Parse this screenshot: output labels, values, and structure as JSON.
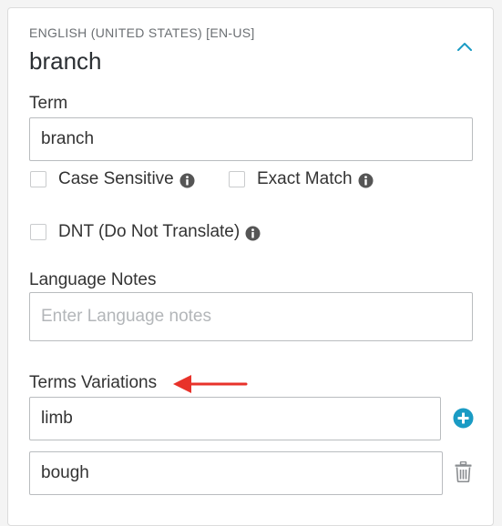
{
  "header": {
    "locale_label": "ENGLISH (UNITED STATES) [EN-US]",
    "term_title": "branch",
    "collapse_icon": "chevron-up-icon"
  },
  "term_field": {
    "label": "Term",
    "value": "branch"
  },
  "options": {
    "case_sensitive": {
      "label": "Case Sensitive",
      "checked": false
    },
    "exact_match": {
      "label": "Exact Match",
      "checked": false
    },
    "dnt": {
      "label": "DNT (Do Not Translate)",
      "checked": false
    }
  },
  "language_notes": {
    "label": "Language Notes",
    "placeholder": "Enter Language notes",
    "value": ""
  },
  "variations": {
    "label": "Terms Variations",
    "items": [
      {
        "value": "limb",
        "action_icon": "plus-circle-icon"
      },
      {
        "value": "bough",
        "action_icon": "trash-icon"
      }
    ]
  },
  "colors": {
    "accent": "#1a9bc4",
    "annotation_arrow": "#e8322a",
    "info_icon": "#555555",
    "trash_icon": "#8a8d90"
  }
}
